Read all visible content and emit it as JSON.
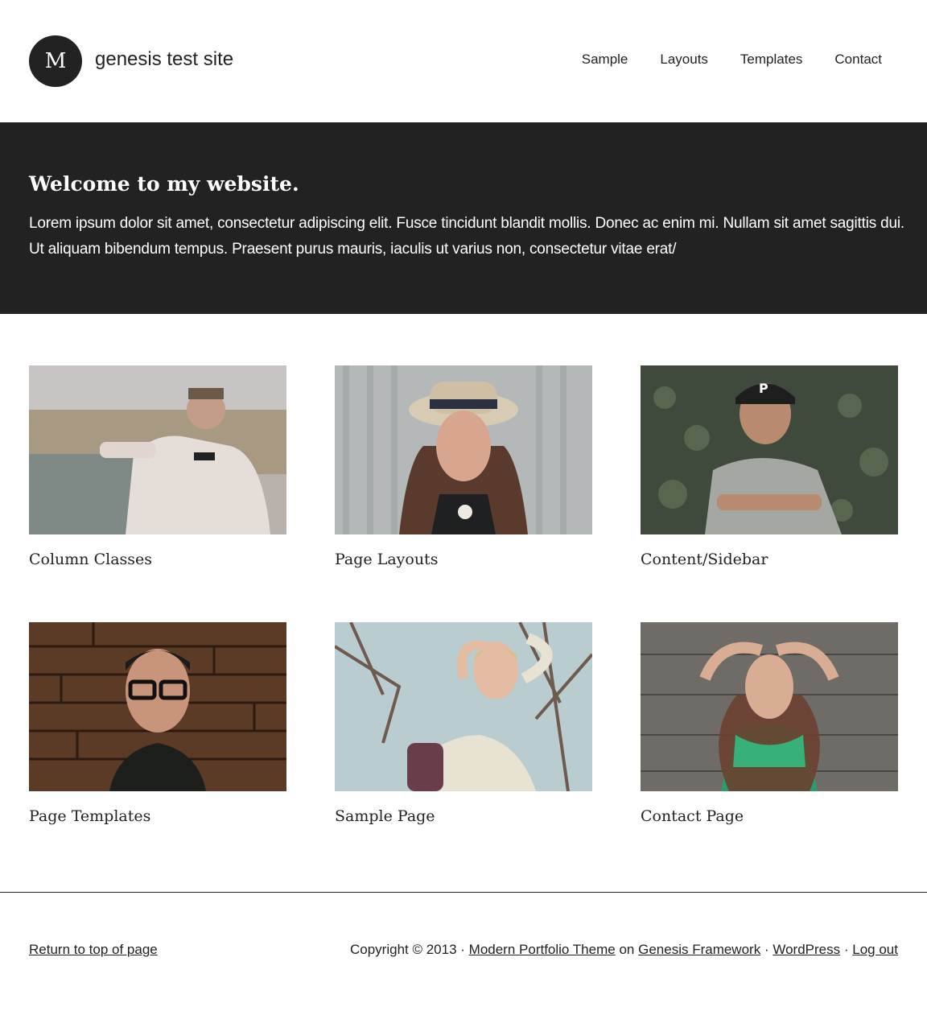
{
  "header": {
    "logo_letter": "M",
    "site_title": "genesis test site",
    "nav": [
      {
        "label": "Sample"
      },
      {
        "label": "Layouts"
      },
      {
        "label": "Templates"
      },
      {
        "label": "Contact"
      }
    ]
  },
  "welcome": {
    "heading": "Welcome to my website.",
    "text": "Lorem ipsum dolor sit amet, consectetur adipiscing elit. Fusce tincidunt blandit mollis. Donec ac enim mi. Nullam sit amet sagittis dui. Ut aliquam bibendum tempus. Praesent purus mauris, iaculis ut varius non, consectetur vitae erat/"
  },
  "portfolio": [
    {
      "title": "Column Classes"
    },
    {
      "title": "Page Layouts"
    },
    {
      "title": "Content/Sidebar"
    },
    {
      "title": "Page Templates"
    },
    {
      "title": "Sample Page"
    },
    {
      "title": "Contact Page"
    }
  ],
  "footer": {
    "back_to_top": "Return to top of page",
    "copyright": "Copyright © 2013 ·",
    "theme_link": "Modern Portfolio Theme",
    "on": "on",
    "framework_link": "Genesis Framework",
    "sep1": "·",
    "wordpress_link": "WordPress",
    "sep2": "·",
    "logout_link": "Log out"
  }
}
